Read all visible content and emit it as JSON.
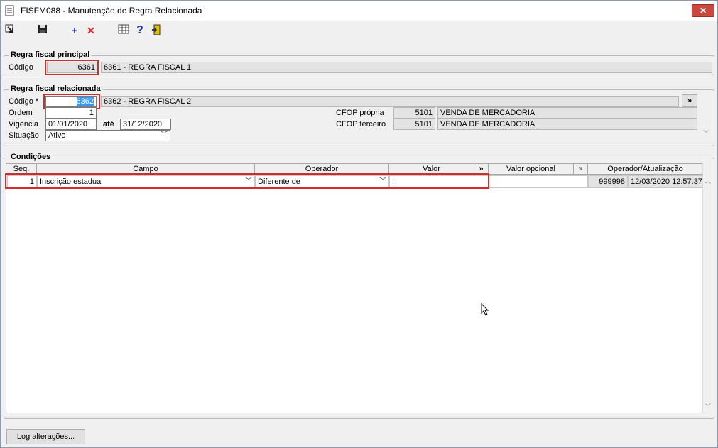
{
  "window": {
    "title": "FISFM088 - Manutenção de Regra Relacionada",
    "close_label": "✕"
  },
  "toolbar": {
    "items": [
      {
        "name": "export-icon"
      },
      {
        "name": "save-icon"
      },
      {
        "name": "add-icon"
      },
      {
        "name": "delete-icon"
      },
      {
        "name": "grid-icon"
      },
      {
        "name": "help-icon"
      },
      {
        "name": "exit-icon"
      }
    ]
  },
  "principal": {
    "title": "Regra fiscal principal",
    "codigo_label": "Código",
    "codigo_value": "6361",
    "descricao": "6361 - REGRA FISCAL 1"
  },
  "relacionada": {
    "title": "Regra fiscal relacionada",
    "codigo_label": "Código *",
    "codigo_value": "6362",
    "descricao": "6362 - REGRA FISCAL 2",
    "lookup_label": "»",
    "ordem_label": "Ordem",
    "ordem_value": "1",
    "vigencia_label": "Vigência",
    "vigencia_inicio": "01/01/2020",
    "ate_label": "até",
    "vigencia_fim": "31/12/2020",
    "situacao_label": "Situação",
    "situacao_value": "Ativo",
    "cfop_propria_label": "CFOP própria",
    "cfop_propria_code": "5101",
    "cfop_propria_desc": "VENDA DE MERCADORIA",
    "cfop_terceiro_label": "CFOP terceiro",
    "cfop_terceiro_code": "5101",
    "cfop_terceiro_desc": "VENDA DE MERCADORIA"
  },
  "condicoes": {
    "title": "Condições",
    "columns": {
      "seq": "Seq.",
      "campo": "Campo",
      "operador": "Operador",
      "valor": "Valor",
      "valor_btn": "»",
      "valor_opcional": "Valor opcional",
      "valor_opcional_btn": "»",
      "operador_atualizacao": "Operador/Atualização"
    },
    "rows": [
      {
        "seq": "1",
        "campo": "Inscrição estadual",
        "operador": "Diferente de",
        "valor": "I",
        "valor_opcional": "",
        "operador_id": "999998",
        "atualizacao": "12/03/2020 12:57:37"
      }
    ]
  },
  "footer": {
    "log_button": "Log alterações..."
  }
}
